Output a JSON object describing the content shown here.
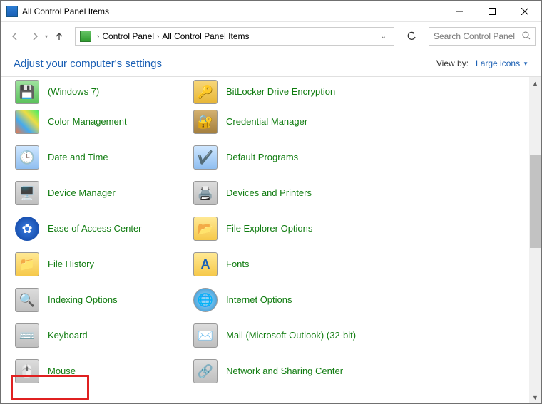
{
  "titlebar": {
    "title": "All Control Panel Items"
  },
  "breadcrumb": {
    "segments": [
      "Control Panel",
      "All Control Panel Items"
    ]
  },
  "search": {
    "placeholder": "Search Control Panel"
  },
  "header": {
    "adjust": "Adjust your computer's settings",
    "viewby_label": "View by:",
    "viewby_value": "Large icons"
  },
  "columns": [
    [
      {
        "label": "(Windows 7)",
        "icon": "backup-icon",
        "truncated_top": true
      },
      {
        "label": "Color Management",
        "icon": "color-icon"
      },
      {
        "label": "Date and Time",
        "icon": "clock-icon"
      },
      {
        "label": "Device Manager",
        "icon": "device-icon"
      },
      {
        "label": "Ease of Access Center",
        "icon": "ease-icon"
      },
      {
        "label": "File History",
        "icon": "folder-history-icon"
      },
      {
        "label": "Indexing Options",
        "icon": "index-icon"
      },
      {
        "label": "Keyboard",
        "icon": "keyboard-icon"
      },
      {
        "label": "Mouse",
        "icon": "mouse-icon",
        "highlighted": true
      }
    ],
    [
      {
        "label": "BitLocker Drive Encryption",
        "icon": "bitlocker-icon",
        "truncated_top": true
      },
      {
        "label": "Credential Manager",
        "icon": "vault-icon"
      },
      {
        "label": "Default Programs",
        "icon": "defaults-icon"
      },
      {
        "label": "Devices and Printers",
        "icon": "printer-icon"
      },
      {
        "label": "File Explorer Options",
        "icon": "explorer-options-icon"
      },
      {
        "label": "Fonts",
        "icon": "fonts-icon"
      },
      {
        "label": "Internet Options",
        "icon": "internet-icon"
      },
      {
        "label": "Mail (Microsoft Outlook) (32-bit)",
        "icon": "mail-icon",
        "multiline": true
      },
      {
        "label": "Network and Sharing Center",
        "icon": "network-icon",
        "multiline": true
      }
    ]
  ]
}
